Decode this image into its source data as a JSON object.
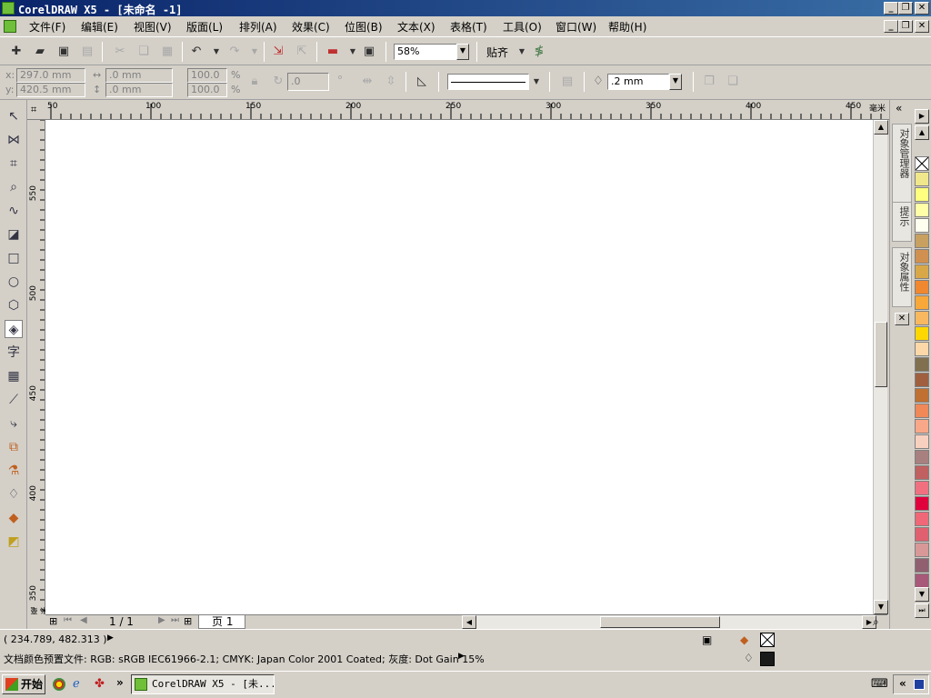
{
  "window": {
    "title": "CorelDRAW X5 - [未命名 -1]",
    "controls": [
      "_",
      "❐",
      "✕"
    ]
  },
  "menu": {
    "items": [
      "文件(F)",
      "编辑(E)",
      "视图(V)",
      "版面(L)",
      "排列(A)",
      "效果(C)",
      "位图(B)",
      "文本(X)",
      "表格(T)",
      "工具(O)",
      "窗口(W)",
      "帮助(H)"
    ]
  },
  "toolbar": {
    "zoom_value": "58%",
    "snap_label": "贴齐"
  },
  "propertybar": {
    "x_label": "x:",
    "x_value": "297.0 mm",
    "y_label": "y:",
    "y_value": "420.5 mm",
    "w_value": ".0 mm",
    "h_value": ".0 mm",
    "scale_x": "100.0",
    "scale_y": "100.0",
    "percent": "%",
    "angle_value": ".0",
    "outline_width": ".2 mm"
  },
  "rulers": {
    "h_labels": [
      "50",
      "100",
      "150",
      "200",
      "250",
      "300",
      "350",
      "400",
      "450"
    ],
    "h_unit": "毫米",
    "v_labels": [
      "550",
      "500",
      "450",
      "400",
      "350"
    ],
    "v_unit": "毫米"
  },
  "pagenav": {
    "page_count": "1 / 1",
    "page_tab": "页 1"
  },
  "dockers": {
    "tab1": "对象管理器",
    "tab2": "提示",
    "tab3": "对象属性"
  },
  "palette": {
    "colors": [
      "#f0e68c",
      "#ffff80",
      "#ffffa8",
      "#fffff0",
      "#c8a060",
      "#d09050",
      "#d8a848",
      "#f08830",
      "#f8a838",
      "#f8b860",
      "#ffd700",
      "#fcd8a8",
      "#807050",
      "#a06040",
      "#c07030",
      "#f08858",
      "#f8a888",
      "#f8d0c0",
      "#a88080",
      "#c06060",
      "#f07080",
      "#e0003c",
      "#f06878",
      "#e06070",
      "#d89898",
      "#906070",
      "#a85878"
    ]
  },
  "status": {
    "coords": "( 234.789, 482.313 )",
    "color_profile": "文档颜色预置文件: RGB: sRGB IEC61966-2.1; CMYK: Japan Color 2001 Coated; 灰度: Dot Gain 15%"
  },
  "taskbar": {
    "start_label": "开始",
    "task_label": "CorelDRAW X5 - [未..."
  }
}
